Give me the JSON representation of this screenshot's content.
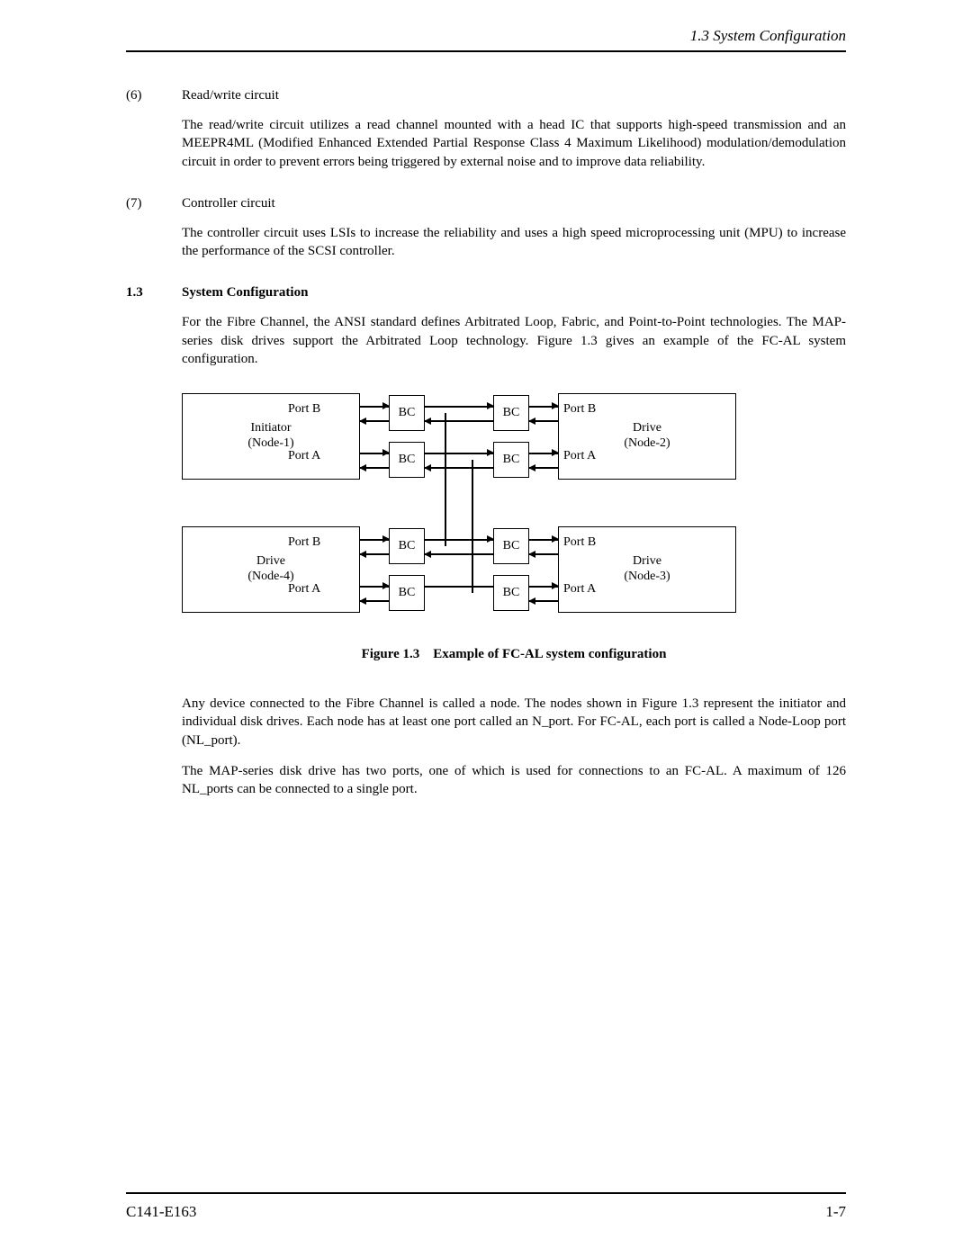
{
  "header": {
    "running_title": "1.3  System Configuration"
  },
  "sections": {
    "s6": {
      "num": "(6)",
      "title": "Read/write circuit",
      "body": "The read/write circuit utilizes a read channel mounted with a head IC that supports high-speed transmission and an MEEPR4ML (Modified Enhanced Extended Partial Response Class 4 Maximum Likelihood) modulation/demodulation circuit in order to prevent errors being triggered by external noise and to improve data reliability."
    },
    "s7": {
      "num": "(7)",
      "title": "Controller circuit",
      "body": "The controller circuit uses LSIs to increase the reliability and uses a high speed microprocessing unit (MPU) to increase the performance of the SCSI controller."
    },
    "s13": {
      "num": "1.3",
      "title": "System Configuration",
      "body": "For the Fibre Channel, the ANSI standard defines Arbitrated Loop, Fabric, and Point-to-Point technologies.  The MAP-series disk drives support the Arbitrated Loop technology.  Figure 1.3 gives an example of the FC-AL system configuration."
    }
  },
  "figure": {
    "caption_label": "Figure 1.3",
    "caption_text": "Example of FC-AL system configuration",
    "nodes": {
      "n1": {
        "l1": "Initiator",
        "l2": "(Node-1)"
      },
      "n2": {
        "l1": "Drive",
        "l2": "(Node-2)"
      },
      "n3": {
        "l1": "Drive",
        "l2": "(Node-3)"
      },
      "n4": {
        "l1": "Drive",
        "l2": "(Node-4)"
      }
    },
    "port_a": "Port A",
    "port_b": "Port B",
    "bc": "BC"
  },
  "after_figure": {
    "p1": "Any device connected to the Fibre Channel is called a node.  The nodes shown in Figure 1.3 represent the initiator and individual disk drives.  Each node has at least one port called an N_port.  For FC-AL, each port is called a Node-Loop port (NL_port).",
    "p2": "The MAP-series disk drive has two ports, one of which is used for connections to an FC-AL.  A maximum of 126 NL_ports can be connected to a single port."
  },
  "footer": {
    "left": "C141-E163",
    "right": "1-7"
  }
}
